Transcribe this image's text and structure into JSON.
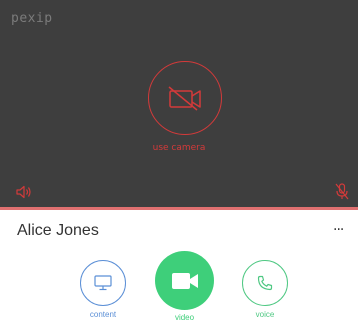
{
  "app": {
    "logo_text": "pexip"
  },
  "preview": {
    "camera_label": "use camera",
    "icons": {
      "camera": "camera-off-icon",
      "speaker": "speaker-icon",
      "mic": "mic-off-icon"
    }
  },
  "participant": {
    "name": "Alice Jones",
    "more_icon": "more-dots-icon",
    "more_glyph": "···"
  },
  "call_types": {
    "content": {
      "label": "content",
      "icon": "monitor-icon"
    },
    "video": {
      "label": "video",
      "icon": "video-camera-icon"
    },
    "voice": {
      "label": "voice",
      "icon": "phone-icon"
    }
  },
  "colors": {
    "preview_bg": "#3e3e3e",
    "danger": "#d33a3a",
    "content_blue": "#5b8fd6",
    "video_green": "#3ecf7a",
    "voice_green": "#4fc883"
  }
}
